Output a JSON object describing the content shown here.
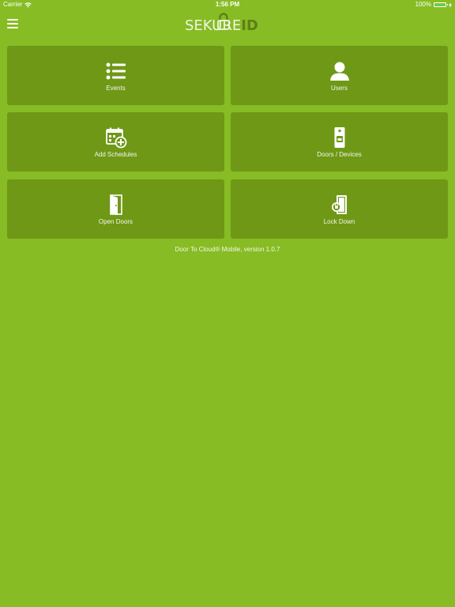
{
  "status_bar": {
    "carrier": "Carrier",
    "time": "1:56 PM",
    "battery_percent": "100%",
    "battery_level": 1.0,
    "battery_color": "#4cd964"
  },
  "header": {
    "menu_icon": "hamburger-menu-icon",
    "logo_text_part1": "SEK",
    "logo_text_part2": "U",
    "logo_text_part3": "RE",
    "logo_text_part4": "ID"
  },
  "tiles": [
    {
      "label": "Events",
      "icon": "list-icon"
    },
    {
      "label": "Users",
      "icon": "user-icon"
    },
    {
      "label": "Add Schedules",
      "icon": "calendar-add-icon"
    },
    {
      "label": "Doors / Devices",
      "icon": "door-device-icon"
    },
    {
      "label": "Open Doors",
      "icon": "open-door-icon"
    },
    {
      "label": "Lock Down",
      "icon": "lock-down-icon"
    }
  ],
  "footer": {
    "version_text": "Door To Cloud® Mobile, version 1.0.7"
  },
  "colors": {
    "background": "#87bc24",
    "tile": "#6f9817",
    "text": "#ffffff"
  }
}
